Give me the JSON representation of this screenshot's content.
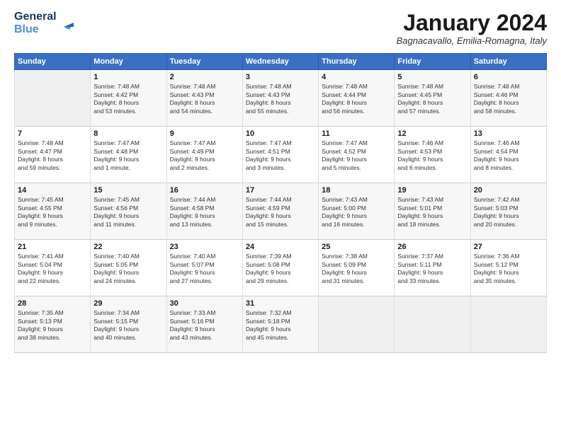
{
  "logo": {
    "line1": "General",
    "line2": "Blue"
  },
  "title": "January 2024",
  "location": "Bagnacavallo, Emilia-Romagna, Italy",
  "weekdays": [
    "Sunday",
    "Monday",
    "Tuesday",
    "Wednesday",
    "Thursday",
    "Friday",
    "Saturday"
  ],
  "weeks": [
    [
      {
        "day": "",
        "info": ""
      },
      {
        "day": "1",
        "info": "Sunrise: 7:48 AM\nSunset: 4:42 PM\nDaylight: 8 hours\nand 53 minutes."
      },
      {
        "day": "2",
        "info": "Sunrise: 7:48 AM\nSunset: 4:43 PM\nDaylight: 8 hours\nand 54 minutes."
      },
      {
        "day": "3",
        "info": "Sunrise: 7:48 AM\nSunset: 4:43 PM\nDaylight: 8 hours\nand 55 minutes."
      },
      {
        "day": "4",
        "info": "Sunrise: 7:48 AM\nSunset: 4:44 PM\nDaylight: 8 hours\nand 56 minutes."
      },
      {
        "day": "5",
        "info": "Sunrise: 7:48 AM\nSunset: 4:45 PM\nDaylight: 8 hours\nand 57 minutes."
      },
      {
        "day": "6",
        "info": "Sunrise: 7:48 AM\nSunset: 4:46 PM\nDaylight: 8 hours\nand 58 minutes."
      }
    ],
    [
      {
        "day": "7",
        "info": "Sunrise: 7:48 AM\nSunset: 4:47 PM\nDaylight: 8 hours\nand 59 minutes."
      },
      {
        "day": "8",
        "info": "Sunrise: 7:47 AM\nSunset: 4:48 PM\nDaylight: 9 hours\nand 1 minute."
      },
      {
        "day": "9",
        "info": "Sunrise: 7:47 AM\nSunset: 4:49 PM\nDaylight: 9 hours\nand 2 minutes."
      },
      {
        "day": "10",
        "info": "Sunrise: 7:47 AM\nSunset: 4:51 PM\nDaylight: 9 hours\nand 3 minutes."
      },
      {
        "day": "11",
        "info": "Sunrise: 7:47 AM\nSunset: 4:52 PM\nDaylight: 9 hours\nand 5 minutes."
      },
      {
        "day": "12",
        "info": "Sunrise: 7:46 AM\nSunset: 4:53 PM\nDaylight: 9 hours\nand 6 minutes."
      },
      {
        "day": "13",
        "info": "Sunrise: 7:46 AM\nSunset: 4:54 PM\nDaylight: 9 hours\nand 8 minutes."
      }
    ],
    [
      {
        "day": "14",
        "info": "Sunrise: 7:45 AM\nSunset: 4:55 PM\nDaylight: 9 hours\nand 9 minutes."
      },
      {
        "day": "15",
        "info": "Sunrise: 7:45 AM\nSunset: 4:56 PM\nDaylight: 9 hours\nand 11 minutes."
      },
      {
        "day": "16",
        "info": "Sunrise: 7:44 AM\nSunset: 4:58 PM\nDaylight: 9 hours\nand 13 minutes."
      },
      {
        "day": "17",
        "info": "Sunrise: 7:44 AM\nSunset: 4:59 PM\nDaylight: 9 hours\nand 15 minutes."
      },
      {
        "day": "18",
        "info": "Sunrise: 7:43 AM\nSunset: 5:00 PM\nDaylight: 9 hours\nand 16 minutes."
      },
      {
        "day": "19",
        "info": "Sunrise: 7:43 AM\nSunset: 5:01 PM\nDaylight: 9 hours\nand 18 minutes."
      },
      {
        "day": "20",
        "info": "Sunrise: 7:42 AM\nSunset: 5:03 PM\nDaylight: 9 hours\nand 20 minutes."
      }
    ],
    [
      {
        "day": "21",
        "info": "Sunrise: 7:41 AM\nSunset: 5:04 PM\nDaylight: 9 hours\nand 22 minutes."
      },
      {
        "day": "22",
        "info": "Sunrise: 7:40 AM\nSunset: 5:05 PM\nDaylight: 9 hours\nand 24 minutes."
      },
      {
        "day": "23",
        "info": "Sunrise: 7:40 AM\nSunset: 5:07 PM\nDaylight: 9 hours\nand 27 minutes."
      },
      {
        "day": "24",
        "info": "Sunrise: 7:39 AM\nSunset: 5:08 PM\nDaylight: 9 hours\nand 29 minutes."
      },
      {
        "day": "25",
        "info": "Sunrise: 7:38 AM\nSunset: 5:09 PM\nDaylight: 9 hours\nand 31 minutes."
      },
      {
        "day": "26",
        "info": "Sunrise: 7:37 AM\nSunset: 5:11 PM\nDaylight: 9 hours\nand 33 minutes."
      },
      {
        "day": "27",
        "info": "Sunrise: 7:36 AM\nSunset: 5:12 PM\nDaylight: 9 hours\nand 35 minutes."
      }
    ],
    [
      {
        "day": "28",
        "info": "Sunrise: 7:35 AM\nSunset: 5:13 PM\nDaylight: 9 hours\nand 38 minutes."
      },
      {
        "day": "29",
        "info": "Sunrise: 7:34 AM\nSunset: 5:15 PM\nDaylight: 9 hours\nand 40 minutes."
      },
      {
        "day": "30",
        "info": "Sunrise: 7:33 AM\nSunset: 5:16 PM\nDaylight: 9 hours\nand 43 minutes."
      },
      {
        "day": "31",
        "info": "Sunrise: 7:32 AM\nSunset: 5:18 PM\nDaylight: 9 hours\nand 45 minutes."
      },
      {
        "day": "",
        "info": ""
      },
      {
        "day": "",
        "info": ""
      },
      {
        "day": "",
        "info": ""
      }
    ]
  ]
}
